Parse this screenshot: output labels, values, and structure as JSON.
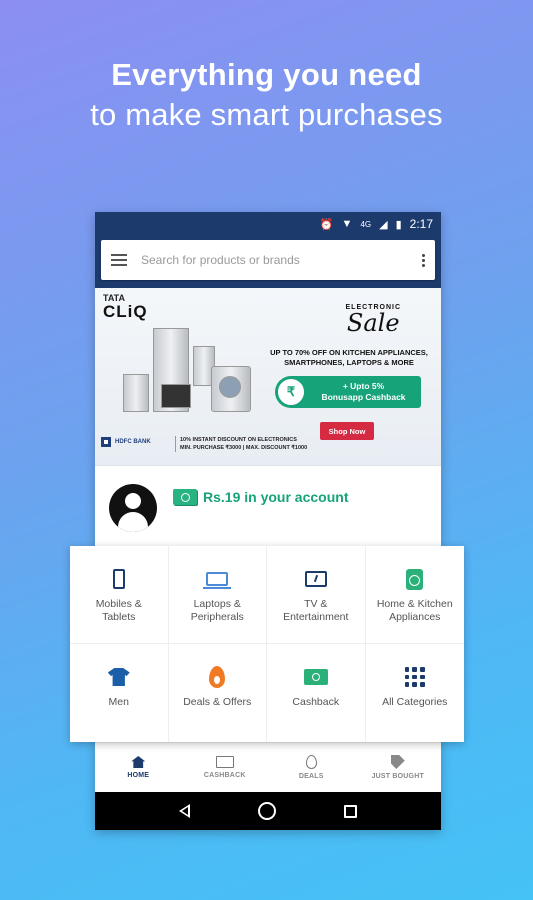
{
  "headline": {
    "line1": "Everything you need",
    "line2": "to make smart purchases"
  },
  "status_bar": {
    "network": "4G",
    "time": "2:17"
  },
  "search": {
    "placeholder": "Search for products or brands"
  },
  "banner": {
    "brand_small": "TATA",
    "brand": "CLiQ",
    "sale_kicker": "ELECTRONIC",
    "sale_title": "Sale",
    "description": "UP TO 70% OFF ON KITCHEN APPLIANCES, SMARTPHONES, LAPTOPS & MORE",
    "cashback_line1": "+ Upto 5%",
    "cashback_line2": "Bonusapp Cashback",
    "cta": "Shop Now",
    "bank_name": "HDFC BANK",
    "bank_offer_line1": "10% INSTANT DISCOUNT ON ELECTRONICS",
    "bank_offer_line2": "MIN. PURCHASE ₹3000 | MAX. DISCOUNT ₹1000"
  },
  "account": {
    "balance_text": "Rs.19 in your account"
  },
  "categories": [
    {
      "label": "Mobiles &\nTablets",
      "icon": "phone-icon"
    },
    {
      "label": "Laptops &\nPeripherals",
      "icon": "laptop-icon"
    },
    {
      "label": "TV &\nEntertainment",
      "icon": "tv-icon"
    },
    {
      "label": "Home & Kitchen\nAppliances",
      "icon": "washing-machine-icon"
    },
    {
      "label": "Men",
      "icon": "tshirt-icon"
    },
    {
      "label": "Deals & Offers",
      "icon": "flame-icon"
    },
    {
      "label": "Cashback",
      "icon": "cash-note-icon"
    },
    {
      "label": "All Categories",
      "icon": "grid-icon"
    }
  ],
  "bottom_nav": [
    {
      "label": "HOME",
      "icon": "home-icon",
      "active": true
    },
    {
      "label": "CASHBACK",
      "icon": "cash-icon",
      "active": false
    },
    {
      "label": "DEALS",
      "icon": "flame-icon",
      "active": false
    },
    {
      "label": "JUST BOUGHT",
      "icon": "tag-icon",
      "active": false
    }
  ],
  "colors": {
    "app_header": "#1c3b6c",
    "accent_green": "#17a37a",
    "cta_red": "#d62a43"
  }
}
